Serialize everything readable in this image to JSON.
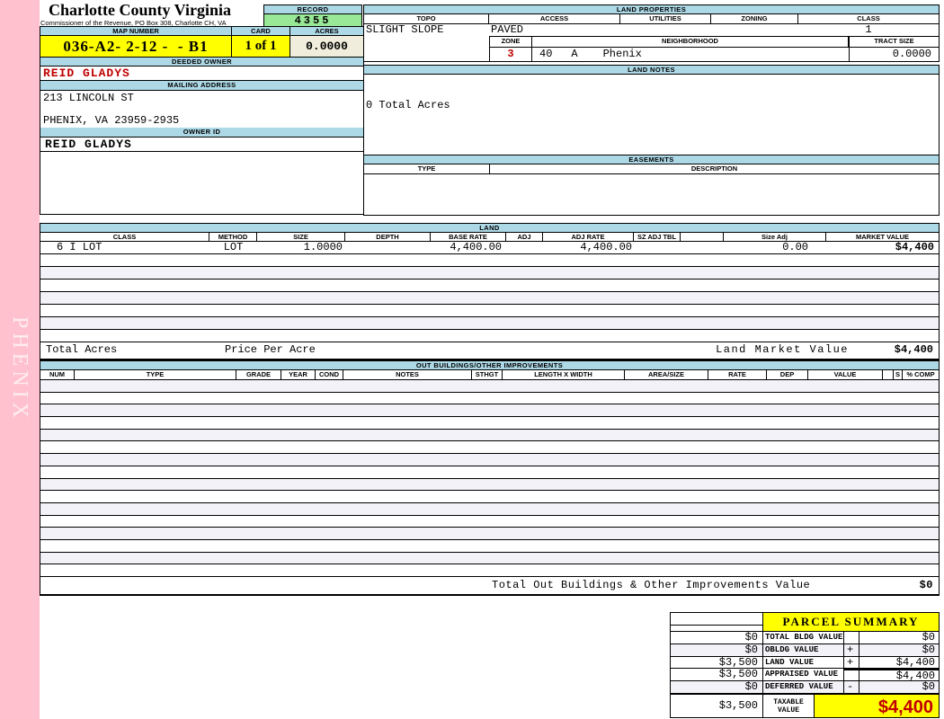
{
  "strip": {
    "text": "PHENIX"
  },
  "header": {
    "title": "Charlotte County Virginia",
    "subtitle": "Commissioner of the Revenue, PO Box 308, Charlotte CH, VA",
    "record_label": "RECORD",
    "record_value": "4355",
    "map_label": "MAP NUMBER",
    "map_value": "036-A2- 2-12 -  - B1",
    "card_label": "CARD",
    "card_value": "1 of 1",
    "acres_label": "ACRES",
    "acres_value": "0.0000"
  },
  "owner": {
    "deeded_label": "DEEDED OWNER",
    "deeded_value": "REID GLADYS",
    "mailing_label": "MAILING ADDRESS",
    "address_line1": "213 LINCOLN ST",
    "address_line2": "PHENIX, VA 23959-2935",
    "owner_id_label": "OWNER ID",
    "owner_id_value": "REID GLADYS"
  },
  "land_properties": {
    "title": "LAND PROPERTIES",
    "headers": [
      "TOPO",
      "ACCESS",
      "UTILITIES",
      "ZONING",
      "CLASS"
    ],
    "values": [
      "SLIGHT SLOPE",
      "PAVED",
      "",
      "",
      "1"
    ],
    "zone_label": "ZONE",
    "zone_value": "3",
    "neighborhood_label": "NEIGHBORHOOD",
    "neighborhood_parts": [
      "40",
      "A",
      "Phenix"
    ],
    "tract_label": "TRACT SIZE",
    "tract_value": "0.0000"
  },
  "land_notes": {
    "title": "LAND NOTES",
    "note": "0 Total Acres"
  },
  "easements": {
    "title": "EASEMENTS",
    "type_label": "TYPE",
    "description_label": "DESCRIPTION"
  },
  "land": {
    "title": "LAND",
    "headers": [
      "CLASS",
      "METHOD",
      "SIZE",
      "DEPTH",
      "BASE RATE",
      "ADJ",
      "ADJ RATE",
      "SZ ADJ TBL",
      "",
      "Size Adj",
      "MARKET VALUE"
    ],
    "row": [
      "6 I LOT",
      "LOT",
      "1.0000",
      "",
      "4,400.00",
      "",
      "4,400.00",
      "",
      "",
      "0.00",
      "$4,400"
    ],
    "empty_row_count": 7,
    "total_acres_label": "Total Acres",
    "price_per_acre_label": "Price Per Acre",
    "market_value_label": "Land Market Value",
    "market_value": "$4,400"
  },
  "out_buildings": {
    "title": "OUT BUILDINGS/OTHER IMPROVEMENTS",
    "headers": [
      "NUM",
      "TYPE",
      "GRADE",
      "YEAR",
      "COND",
      "NOTES",
      "STHGT",
      "LENGTH X WIDTH",
      "AREA/SIZE",
      "RATE",
      "DEP",
      "VALUE",
      "",
      "S",
      "% COMP"
    ],
    "empty_row_count": 16,
    "total_label": "Total Out Buildings & Other Improvements Value",
    "total_value": "$0"
  },
  "parcel_summary": {
    "title": "PARCEL SUMMARY",
    "rows": [
      {
        "left": "$0",
        "label": "TOTAL BLDG VALUE",
        "op": "",
        "value": "$0"
      },
      {
        "left": "$0",
        "label": "OBLDG VALUE",
        "op": "+",
        "value": "$0"
      },
      {
        "left": "$3,500",
        "label": "LAND VALUE",
        "op": "+",
        "value": "$4,400"
      },
      {
        "left": "$3,500",
        "label": "APPRAISED VALUE",
        "op": "",
        "value": "$4,400"
      },
      {
        "left": "$0",
        "label": "DEFERRED VALUE",
        "op": "-",
        "value": "$0"
      }
    ],
    "taxable_left": "$3,500",
    "taxable_label": "TAXABLE VALUE",
    "taxable_value": "$4,400"
  },
  "colors": {
    "header_blue": "#ADD8E6",
    "record_green": "#98E898",
    "highlight_yellow": "#FFFF00",
    "alert_red": "#C00000",
    "strip_pink": "#FFC1CE",
    "cream": "#F0EDDC",
    "stripe_lavender": "#F2F2F8"
  }
}
